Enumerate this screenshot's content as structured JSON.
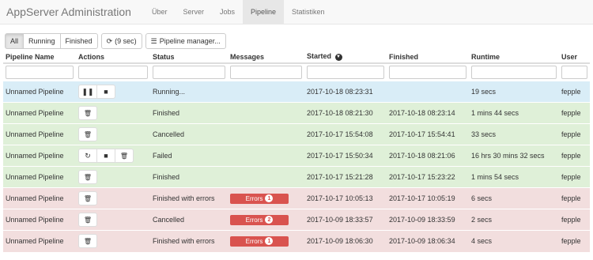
{
  "navbar": {
    "brand": "AppServer Administration",
    "items": [
      {
        "label": "Über",
        "active": false
      },
      {
        "label": "Server",
        "active": false
      },
      {
        "label": "Jobs",
        "active": false
      },
      {
        "label": "Pipeline",
        "active": true
      },
      {
        "label": "Statistiken",
        "active": false
      }
    ]
  },
  "toolbar": {
    "filters": [
      "All",
      "Running",
      "Finished"
    ],
    "active_filter": "All",
    "refresh_label": "(9 sec)",
    "refresh_icon": "refresh-icon",
    "manager_label": "Pipeline manager...",
    "manager_icon": "list-icon"
  },
  "table": {
    "headers": {
      "name": "Pipeline Name",
      "actions": "Actions",
      "status": "Status",
      "messages": "Messages",
      "started": "Started",
      "finished": "Finished",
      "runtime": "Runtime",
      "user": "User"
    },
    "sort_icon": "chevron-down-circle-icon",
    "errors_label": "Errors",
    "rows": [
      {
        "name": "Unnamed Pipeline",
        "state": "info",
        "actions": [
          "pause",
          "stop"
        ],
        "status": "Running...",
        "errors": "",
        "started": "2017-10-18 08:23:31",
        "finished": "",
        "runtime": "19 secs",
        "user": "fepple"
      },
      {
        "name": "Unnamed Pipeline",
        "state": "success",
        "actions": [
          "delete"
        ],
        "status": "Finished",
        "errors": "",
        "started": "2017-10-18 08:21:30",
        "finished": "2017-10-18 08:23:14",
        "runtime": "1 mins 44 secs",
        "user": "fepple"
      },
      {
        "name": "Unnamed Pipeline",
        "state": "success",
        "actions": [
          "delete"
        ],
        "status": "Cancelled",
        "errors": "",
        "started": "2017-10-17 15:54:08",
        "finished": "2017-10-17 15:54:41",
        "runtime": "33 secs",
        "user": "fepple"
      },
      {
        "name": "Unnamed Pipeline",
        "state": "success",
        "actions": [
          "restart",
          "stop",
          "delete"
        ],
        "status": "Failed",
        "errors": "",
        "started": "2017-10-17 15:50:34",
        "finished": "2017-10-18 08:21:06",
        "runtime": "16 hrs 30 mins 32 secs",
        "user": "fepple"
      },
      {
        "name": "Unnamed Pipeline",
        "state": "success",
        "actions": [
          "delete"
        ],
        "status": "Finished",
        "errors": "",
        "started": "2017-10-17 15:21:28",
        "finished": "2017-10-17 15:23:22",
        "runtime": "1 mins 54 secs",
        "user": "fepple"
      },
      {
        "name": "Unnamed Pipeline",
        "state": "danger",
        "actions": [
          "delete"
        ],
        "status": "Finished with errors",
        "errors": "1",
        "started": "2017-10-17 10:05:13",
        "finished": "2017-10-17 10:05:19",
        "runtime": "6 secs",
        "user": "fepple"
      },
      {
        "name": "Unnamed Pipeline",
        "state": "danger",
        "actions": [
          "delete"
        ],
        "status": "Cancelled",
        "errors": "2",
        "started": "2017-10-09 18:33:57",
        "finished": "2017-10-09 18:33:59",
        "runtime": "2 secs",
        "user": "fepple"
      },
      {
        "name": "Unnamed Pipeline",
        "state": "danger",
        "actions": [
          "delete"
        ],
        "status": "Finished with errors",
        "errors": "1",
        "started": "2017-10-09 18:06:30",
        "finished": "2017-10-09 18:06:34",
        "runtime": "4 secs",
        "user": "fepple"
      }
    ]
  }
}
